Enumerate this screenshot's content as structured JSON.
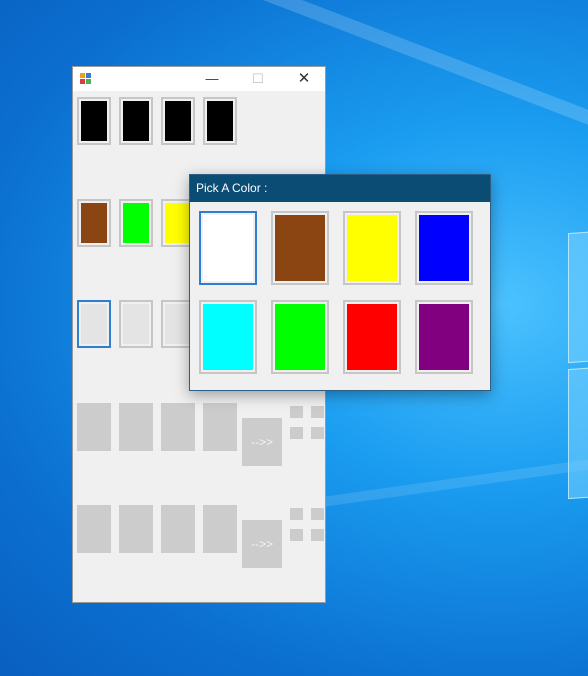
{
  "form": {
    "title": "",
    "controls": {
      "minimize": "—",
      "maximize": "☐",
      "close": "✕"
    },
    "row1_colors": [
      "#000000",
      "#000000",
      "#000000",
      "#000000"
    ],
    "row2_colors": [
      "#8b4513",
      "#00ff00",
      "#ffff00"
    ],
    "row3_colors": [
      "#e4e4e4",
      "#e4e4e4",
      "#e4e4e4"
    ],
    "arrow_label_1": "-->>",
    "arrow_label_2": "-->>"
  },
  "dialog": {
    "title": "Pick A Color :",
    "colors": [
      "#ffffff",
      "#8b4513",
      "#ffff00",
      "#0000ff",
      "#00ffff",
      "#00ff00",
      "#ff0000",
      "#800080"
    ],
    "selected_index": 0
  }
}
